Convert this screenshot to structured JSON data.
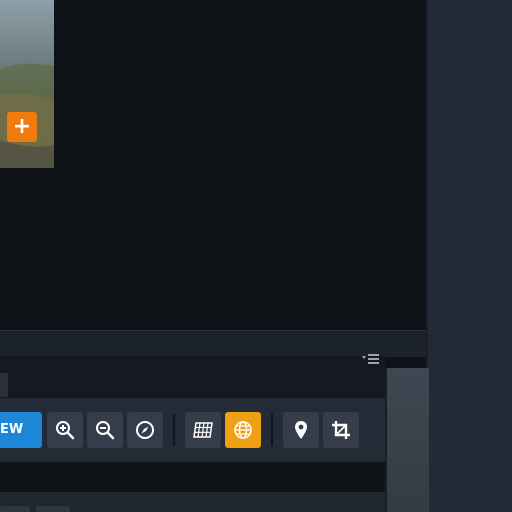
{
  "thumbnail": {
    "add_label": "+"
  },
  "toolbar": {
    "view_label": "EW",
    "buttons": [
      {
        "name": "zoom-in-button",
        "icon": "zoom-in-icon"
      },
      {
        "name": "zoom-out-button",
        "icon": "zoom-out-icon"
      },
      {
        "name": "compass-button",
        "icon": "compass-icon"
      },
      {
        "name": "grid-button",
        "icon": "grid-icon"
      },
      {
        "name": "globe-button",
        "icon": "globe-icon",
        "active": true
      },
      {
        "name": "location-pin-button",
        "icon": "map-pin-icon"
      },
      {
        "name": "crop-button",
        "icon": "crop-icon"
      }
    ],
    "active_color": "#f0a015",
    "view_color": "#1e86d6"
  },
  "panel": {
    "menu_icon": "panel-menu-icon"
  },
  "colors": {
    "accent": "#f07a0c",
    "background": "#0e1116"
  }
}
